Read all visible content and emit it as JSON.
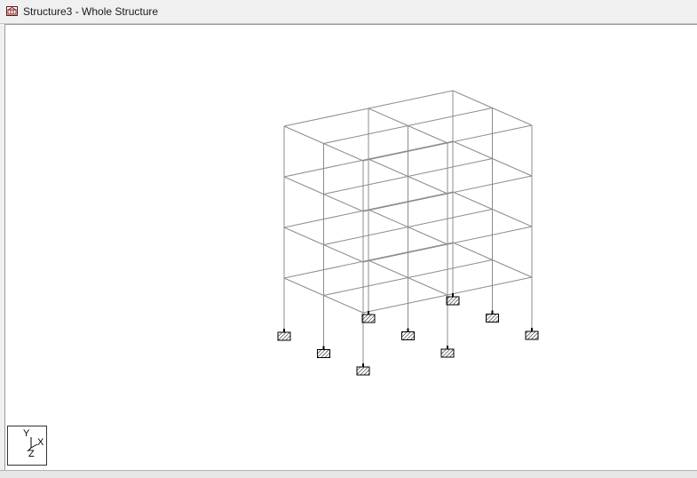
{
  "window": {
    "title": "Structure3 - Whole Structure",
    "icon": "structure-window-icon"
  },
  "viewport": {
    "view": "isometric",
    "line_color": "#8c8c8c",
    "support_color": "#000000",
    "background": "#ffffff"
  },
  "axis_triad": {
    "y_label": "Y",
    "x_label": "X",
    "z_label": "Z"
  }
}
